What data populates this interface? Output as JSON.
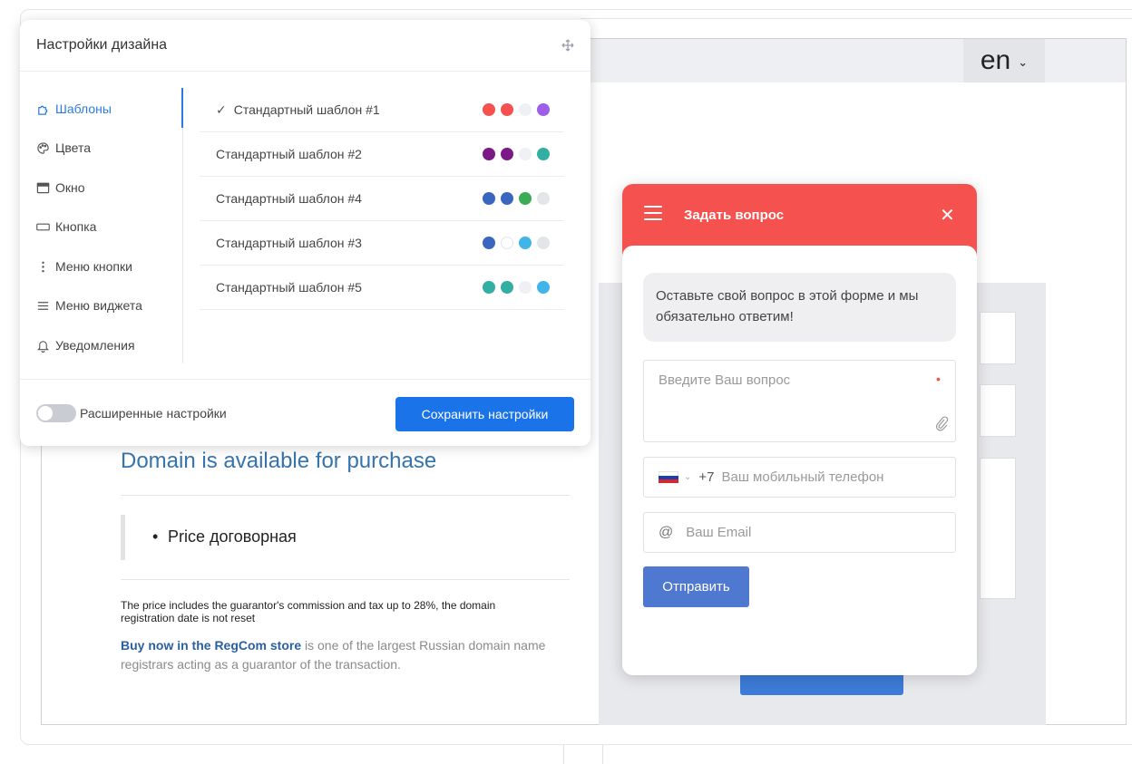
{
  "language_selector": {
    "value": "en"
  },
  "background_page": {
    "domain_title": "Domain is available for purchase",
    "price_item": "Price договорная",
    "fine_print": "The price includes the guarantor's commission and tax up to 28%, the domain registration date is not reset",
    "buy_link": "Buy now in the RegCom store",
    "buy_text": " is one of the largest Russian domain name registrars acting as a guarantor of the transaction."
  },
  "settings_panel": {
    "title": "Настройки дизайна",
    "nav": [
      {
        "label": "Шаблоны",
        "icon": "puzzle-icon",
        "active": true
      },
      {
        "label": "Цвета",
        "icon": "palette-icon",
        "active": false
      },
      {
        "label": "Окно",
        "icon": "window-icon",
        "active": false
      },
      {
        "label": "Кнопка",
        "icon": "button-icon",
        "active": false
      },
      {
        "label": "Меню кнопки",
        "icon": "vertical-dots-icon",
        "active": false
      },
      {
        "label": "Меню виджета",
        "icon": "hamburger-icon",
        "active": false
      },
      {
        "label": "Уведомления",
        "icon": "bell-icon",
        "active": false
      }
    ],
    "templates": [
      {
        "name": "Стандартный шаблон #1",
        "selected": true,
        "colors": [
          "#f4514f",
          "#f4514f",
          "#eef0f3",
          "#9d5ee8"
        ]
      },
      {
        "name": "Стандартный шаблон #2",
        "selected": false,
        "colors": [
          "#7b1a86",
          "#7b1a86",
          "#eef0f3",
          "#33aea3"
        ]
      },
      {
        "name": "Стандартный шаблон #4",
        "selected": false,
        "colors": [
          "#3a66bf",
          "#3a66bf",
          "#3bab58",
          "#e3e5e8"
        ]
      },
      {
        "name": "Стандартный шаблон #3",
        "selected": false,
        "colors": [
          "#3a66bf",
          "#ffffff",
          "#41b4e8",
          "#e3e5e8"
        ]
      },
      {
        "name": "Стандартный шаблон #5",
        "selected": false,
        "colors": [
          "#33aea3",
          "#33aea3",
          "#eef0f3",
          "#41b4e8"
        ]
      }
    ],
    "advanced_toggle_label": "Расширенные настройки",
    "save_label": "Сохранить настройки"
  },
  "widget": {
    "title": "Задать вопрос",
    "message": "Оставьте свой вопрос в этой форме и мы обязательно ответим!",
    "question_placeholder": "Введите Ваш вопрос",
    "required_mark": "•",
    "phone_code": "+7",
    "phone_placeholder": "Ваш мобильный телефон",
    "email_placeholder": "Ваш Email",
    "submit_label": "Отправить",
    "header_color": "#f4514f",
    "button_color": "#4f79d1"
  }
}
